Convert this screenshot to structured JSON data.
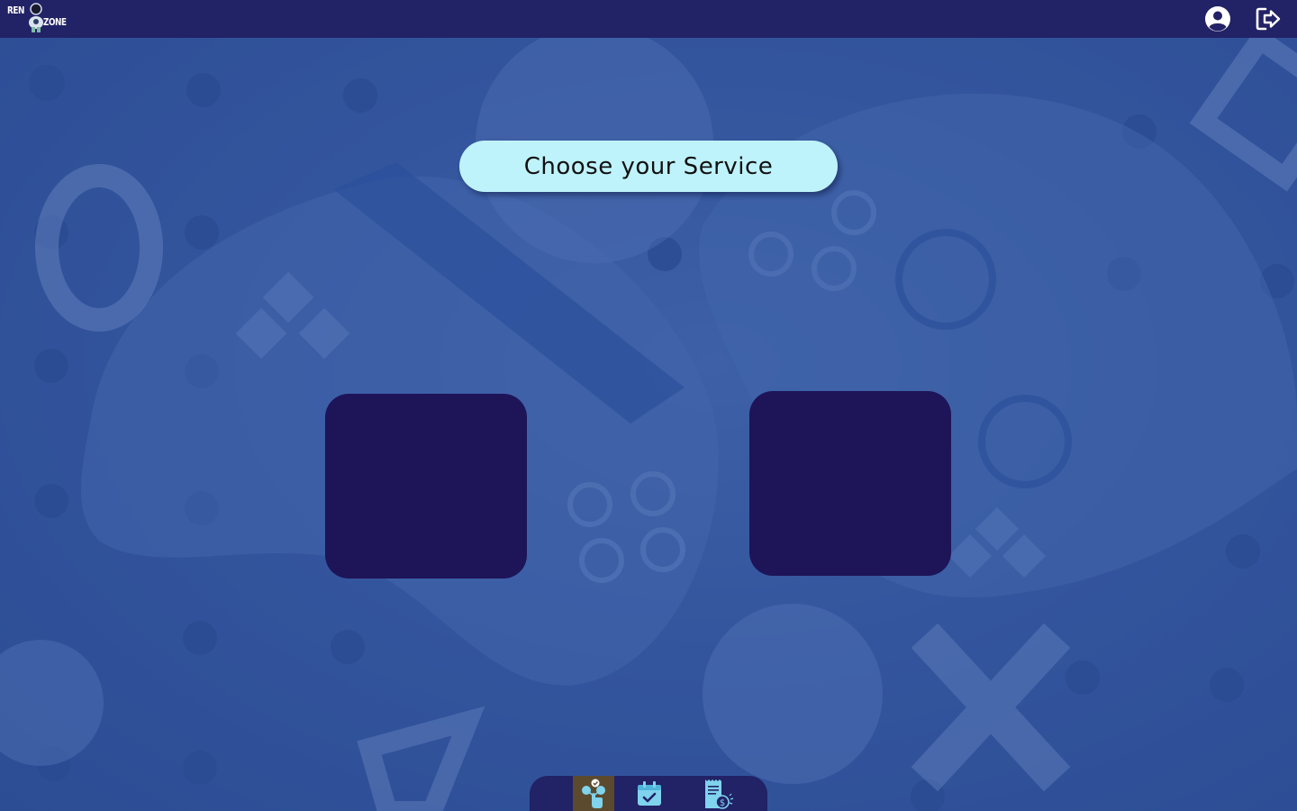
{
  "app": {
    "logo_top": "REN",
    "logo_bottom": "ZONE"
  },
  "header": {
    "profile_icon": "user-circle-icon",
    "logout_icon": "logout-icon"
  },
  "main": {
    "title": "Choose your Service",
    "cards": [
      {
        "name": "service-card-1"
      },
      {
        "name": "service-card-2"
      }
    ]
  },
  "bottom_nav": {
    "items": [
      {
        "icon": "select-service-icon",
        "active": true
      },
      {
        "icon": "calendar-check-icon",
        "active": false
      },
      {
        "icon": "billing-receipt-icon",
        "active": false
      }
    ]
  },
  "colors": {
    "topbar": "#222266",
    "background": "#35599b",
    "title_pill": "#bff3fb",
    "card": "#1e1458",
    "active_nav": "#5b4a2e",
    "icon_accent": "#7fd3ec"
  }
}
